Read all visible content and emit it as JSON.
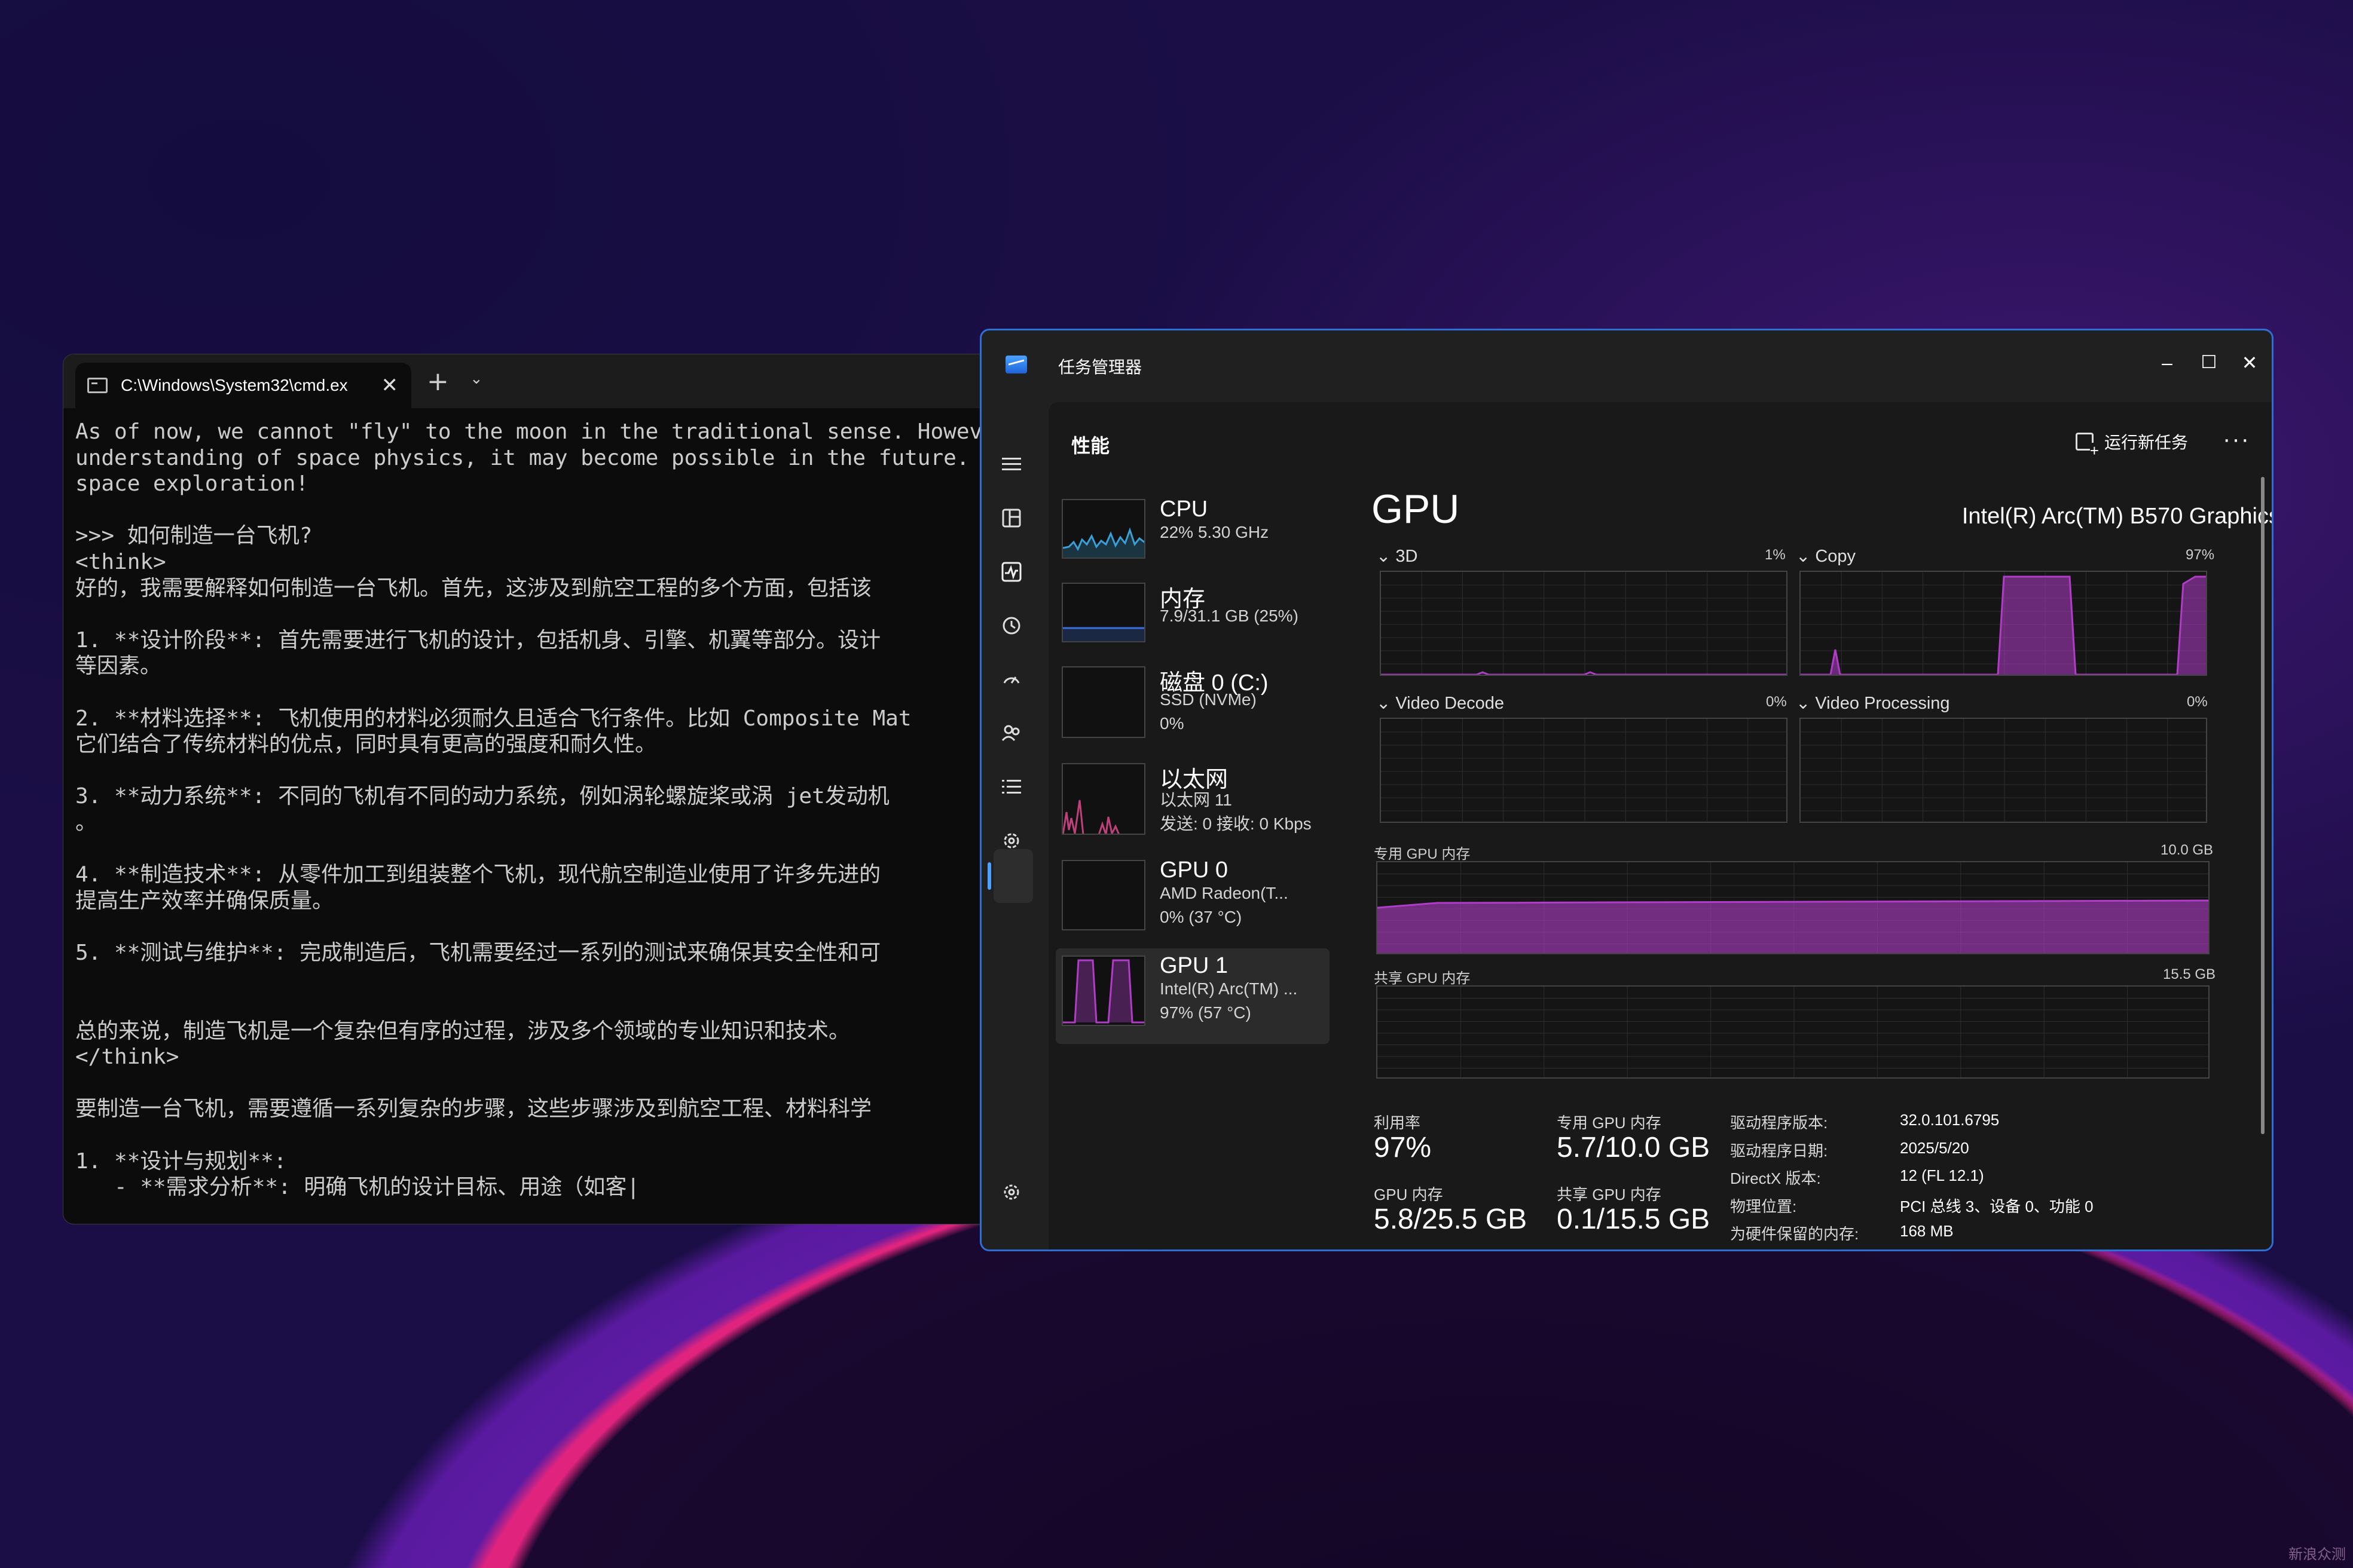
{
  "cmd": {
    "tab_title": "C:\\Windows\\System32\\cmd.ex",
    "tab_close": "✕",
    "new_tab": "+",
    "dropdown": "⌄",
    "lines": [
      "As of now, we cannot \"fly\" to the moon in the traditional sense. However",
      "understanding of space physics, it may become possible in the future. Sta",
      "space exploration!",
      "",
      ">>> 如何制造一台飞机?",
      "<think>",
      "好的，我需要解释如何制造一台飞机。首先，这涉及到航空工程的多个方面，包括该",
      "",
      "1. **设计阶段**: 首先需要进行飞机的设计，包括机身、引擎、机翼等部分。设计",
      "等因素。",
      "",
      "2. **材料选择**: 飞机使用的材料必须耐久且适合飞行条件。比如 Composite Mat",
      "它们结合了传统材料的优点，同时具有更高的强度和耐久性。",
      "",
      "3. **动力系统**: 不同的飞机有不同的动力系统，例如涡轮螺旋桨或涡 jet发动机",
      "。",
      "",
      "4. **制造技术**: 从零件加工到组装整个飞机，现代航空制造业使用了许多先进的",
      "提高生产效率并确保质量。",
      "",
      "5. **测试与维护**: 完成制造后，飞机需要经过一系列的测试来确保其安全性和可",
      "",
      "",
      "总的来说，制造飞机是一个复杂但有序的过程，涉及多个领域的专业知识和技术。",
      "</think>",
      "",
      "要制造一台飞机，需要遵循一系列复杂的步骤，这些步骤涉及到航空工程、材料科学",
      "",
      "1. **设计与规划**:",
      "   - **需求分析**: 明确飞机的设计目标、用途（如客|"
    ]
  },
  "tm": {
    "title": "任务管理器",
    "minimize": "–",
    "maximize": "☐",
    "close": "✕",
    "heading": "性能",
    "run_task": "运行新任务",
    "more": "···",
    "devices": [
      {
        "name": "CPU",
        "sub1": "22% 5.30 GHz"
      },
      {
        "name": "内存",
        "sub1": "7.9/31.1 GB (25%)"
      },
      {
        "name": "磁盘 0 (C:)",
        "sub1": "SSD (NVMe)",
        "sub2": "0%"
      },
      {
        "name": "以太网",
        "sub1": "以太网 11",
        "sub2": "发送: 0 接收: 0 Kbps"
      },
      {
        "name": "GPU 0",
        "sub1": "AMD Radeon(T...",
        "sub2": "0% (37 °C)"
      },
      {
        "name": "GPU 1",
        "sub1": "Intel(R) Arc(TM) ...",
        "sub2": "97% (57 °C)"
      }
    ],
    "gpu": {
      "title": "GPU",
      "model": "Intel(R) Arc(TM) B570 Graphics",
      "engines": [
        {
          "label": "3D",
          "pct": "1%"
        },
        {
          "label": "Copy",
          "pct": "97%"
        },
        {
          "label": "Video Decode",
          "pct": "0%"
        },
        {
          "label": "Video Processing",
          "pct": "0%"
        }
      ],
      "dedicated_label": "专用 GPU 内存",
      "dedicated_max": "10.0 GB",
      "shared_label": "共享 GPU 内存",
      "shared_max": "15.5 GB",
      "stats": {
        "util_label": "利用率",
        "util_value": "97%",
        "ded_label": "专用 GPU 内存",
        "ded_value": "5.7/10.0 GB",
        "gpumem_label": "GPU 内存",
        "gpumem_value": "5.8/25.5 GB",
        "shared_label": "共享 GPU 内存",
        "shared_value": "0.1/15.5 GB"
      },
      "details": [
        {
          "k": "驱动程序版本:",
          "v": "32.0.101.6795"
        },
        {
          "k": "驱动程序日期:",
          "v": "2025/5/20"
        },
        {
          "k": "DirectX 版本:",
          "v": "12 (FL 12.1)"
        },
        {
          "k": "物理位置:",
          "v": "PCI 总线 3、设备 0、功能 0"
        },
        {
          "k": "为硬件保留的内存:",
          "v": "168 MB"
        }
      ]
    }
  },
  "colors": {
    "gpu_accent": "#b03cc8",
    "cpu_accent": "#3aa0d8",
    "mem_accent": "#3c6fe0",
    "eth_accent": "#c0407c",
    "window_border": "#2f6fd4"
  },
  "watermark": "新浪众测"
}
